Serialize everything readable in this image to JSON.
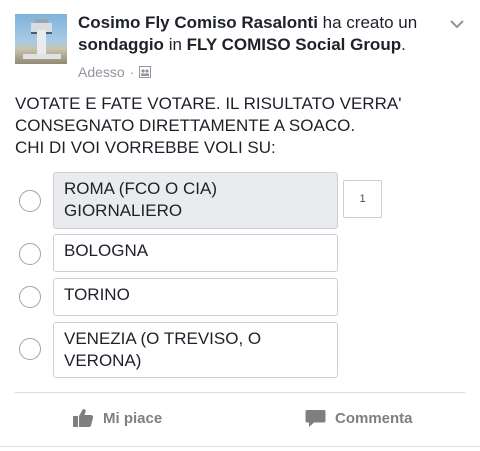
{
  "post": {
    "author": "Cosimo Fly Comiso Rasalonti",
    "action_text": "ha creato un",
    "object": "sondaggio",
    "preposition": "in",
    "group": "FLY COMISO Social Group",
    "period": ".",
    "timestamp": "Adesso",
    "separator": "·",
    "audience_icon": "group-icon",
    "text_lines": [
      "VOTATE E FATE VOTARE. IL RISULTATO VERRA'",
      "CONSEGNATO DIRETTAMENTE A SOACO.",
      "CHI DI VOI VORREBBE VOLI SU:"
    ]
  },
  "poll": {
    "options": [
      {
        "label": "ROMA (FCO O CIA) GIORNALIERO",
        "votes": "1"
      },
      {
        "label": "BOLOGNA",
        "votes": ""
      },
      {
        "label": "TORINO",
        "votes": ""
      },
      {
        "label": "VENEZIA (O TREVISO, O VERONA)",
        "votes": ""
      }
    ]
  },
  "actions": {
    "like": "Mi piace",
    "comment": "Commenta"
  },
  "colors": {
    "text": "#1d2129",
    "meta": "#90949c",
    "border": "#ccd0d5",
    "voted_bg": "#e9ebee",
    "action": "#7f7f7f"
  }
}
